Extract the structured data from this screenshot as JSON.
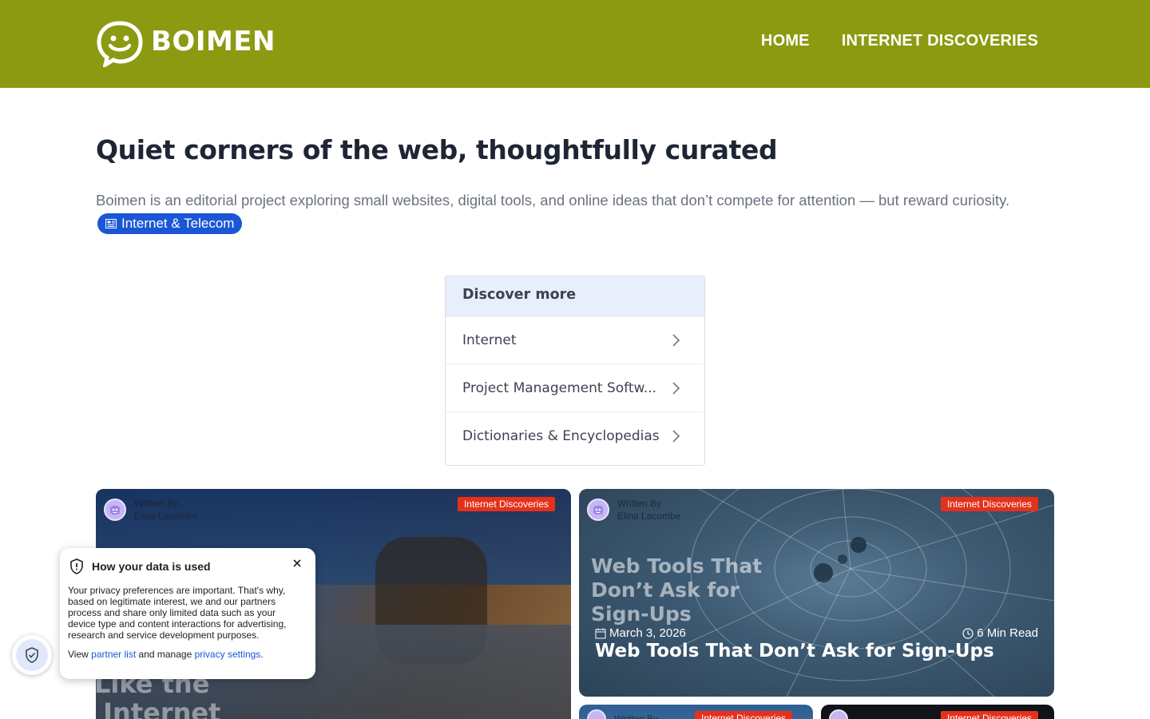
{
  "header": {
    "logo_text": "BOIMEN",
    "nav": [
      {
        "label": "HOME"
      },
      {
        "label": "INTERNET DISCOVERIES"
      }
    ],
    "background_color": "#8c9a12"
  },
  "hero": {
    "title": "Quiet corners of the web, thoughtfully curated",
    "description": "Boimen is an editorial project exploring small websites, digital tools, and online ideas that don’t compete for attention — but reward curiosity.",
    "topic_chip": "Internet & Telecom",
    "topic_chip_color": "#1a56d6"
  },
  "discover": {
    "heading": "Discover more",
    "items": [
      {
        "label": "Internet"
      },
      {
        "label": "Project Management Softw..."
      },
      {
        "label": "Dictionaries & Encyclopedias"
      }
    ]
  },
  "cards": [
    {
      "author_prefix": "Written By",
      "author_name": "Elina Lacombe",
      "category": "Internet Discoveries",
      "image_text": "Like the\n Internet"
    },
    {
      "author_prefix": "Written By",
      "author_name": "Elina Lacombe",
      "category": "Internet Discoveries",
      "image_text": "Web Tools That Don’t Ask for Sign-Ups",
      "date": "March 3, 2026",
      "read_time": "6 Min Read",
      "title": "Web Tools That Don’t Ask for Sign-Ups"
    },
    {
      "author_prefix": "Written By",
      "category": "Internet Discoveries"
    },
    {
      "category": "Internet Discoveries"
    }
  ],
  "privacy": {
    "title": "How your data is used",
    "body": "Your privacy preferences are important. That's why, based on legitimate interest, we and our partners process and share only limited data such as your device type and content interactions for advertising, research and service development purposes.",
    "footer_prefix": "View",
    "partner_link": "partner list",
    "footer_middle": "and manage",
    "settings_link": "privacy settings",
    "footer_suffix": "."
  },
  "colors": {
    "badge": "#e5311c",
    "link": "#1a56d6"
  }
}
